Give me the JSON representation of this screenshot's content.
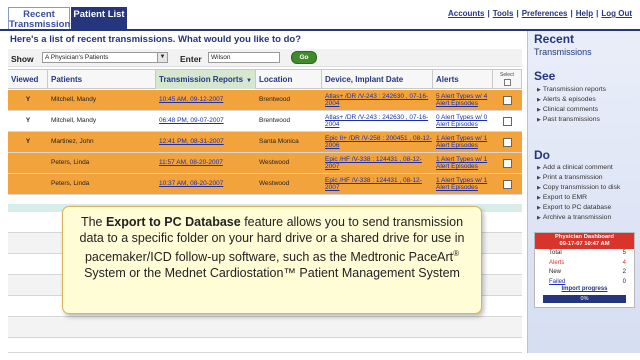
{
  "tabs": [
    {
      "label": "Recent Transmissions"
    },
    {
      "label": "Patient List"
    }
  ],
  "toplinks": [
    "Accounts",
    "Tools",
    "Preferences",
    "Help",
    "Log Out"
  ],
  "main": {
    "heading": "Here's a list of recent transmissions. What would you like to do?",
    "show_label": "Show",
    "show_value": "A Physician's Patients",
    "enter_label": "Enter",
    "enter_value": "Wilson",
    "go_label": "Go"
  },
  "table": {
    "columns": [
      "Viewed",
      "Patients",
      "Transmission Reports",
      "Location",
      "Device, Implant Date",
      "Alerts",
      "Select"
    ],
    "rows": [
      {
        "viewed": "Y",
        "patient": "Mitchell, Mandy",
        "report": "10:45 AM, 09-12-2007",
        "location": "Brentwood",
        "device": "Atlas+ /DR /V-243 : 242630 , 07-16-2004",
        "alerts": "5 Alert Types w/ 4 Alert Episodes",
        "style": "orange"
      },
      {
        "viewed": "Y",
        "patient": "Mitchell, Mandy",
        "report": "06:48 PM, 09-07-2007",
        "location": "Brentwood",
        "device": "Atlas+ /DR /V-243 : 242630 , 07-16-2004",
        "alerts": "0 Alert Types w/ 0 Alert Episodes",
        "style": "white"
      },
      {
        "viewed": "Y",
        "patient": "Martinez, John",
        "report": "12:41 PM, 08-31-2007",
        "location": "Santa Monica",
        "device": "Epic II+ /DR /V-258 : 200451 , 08-12-2006",
        "alerts": "1 Alert Types w/ 1 Alert Episodes",
        "style": "orange"
      },
      {
        "viewed": "",
        "patient": "Peters, Linda",
        "report": "11:57 AM, 08-20-2007",
        "location": "Westwood",
        "device": "Epic /HF /V-338 : 124431 , 08-12-2007",
        "alerts": "1 Alert Types w/ 1 Alert Episodes",
        "style": "orange"
      },
      {
        "viewed": "",
        "patient": "Peters, Linda",
        "report": "10:37 AM, 08-20-2007",
        "location": "Westwood",
        "device": "Epic /HF /V-338 : 124431 , 08-12-2007",
        "alerts": "1 Alert Types w/ 1 Alert Episodes",
        "style": "orange"
      }
    ]
  },
  "callout": {
    "part1": "The ",
    "bold": "Export to PC Database",
    "part2": " feature allows you to send transmission data to a specific folder on your hard drive or a shared drive for use in pacemaker/ICD follow-up software, such as the Medtronic PaceArt",
    "sup": "®",
    "part3": " System or the Mednet Cardiostation™ Patient Management System"
  },
  "sidebar": {
    "title": "Recent",
    "subtitle": "Transmissions",
    "see_heading": "See",
    "see_items": [
      "Transmission reports",
      "Alerts & episodes",
      "Clinical comments",
      "Past transmissions"
    ],
    "do_heading": "Do",
    "do_items": [
      "Add a clinical comment",
      "Print a transmission",
      "Copy transmission to disk",
      "Export to EMR",
      "Export to PC database",
      "Archive a transmission"
    ],
    "dashboard": {
      "title": "Physician Dashboard",
      "datetime": "09-17-07 10:47 AM",
      "rows": [
        {
          "label": "Total",
          "value": "5"
        },
        {
          "label": "Alerts",
          "value": "4"
        },
        {
          "label": "New",
          "value": "2"
        },
        {
          "label": "Failed",
          "value": "0"
        }
      ],
      "progress_label": "Import progress",
      "progress_text": "0%",
      "progress_value": 0
    }
  },
  "colors": {
    "navy": "#25367e",
    "orange_row": "#f2a33c",
    "callout_bg": "#fffdd6",
    "alert_red": "#d9342b"
  }
}
